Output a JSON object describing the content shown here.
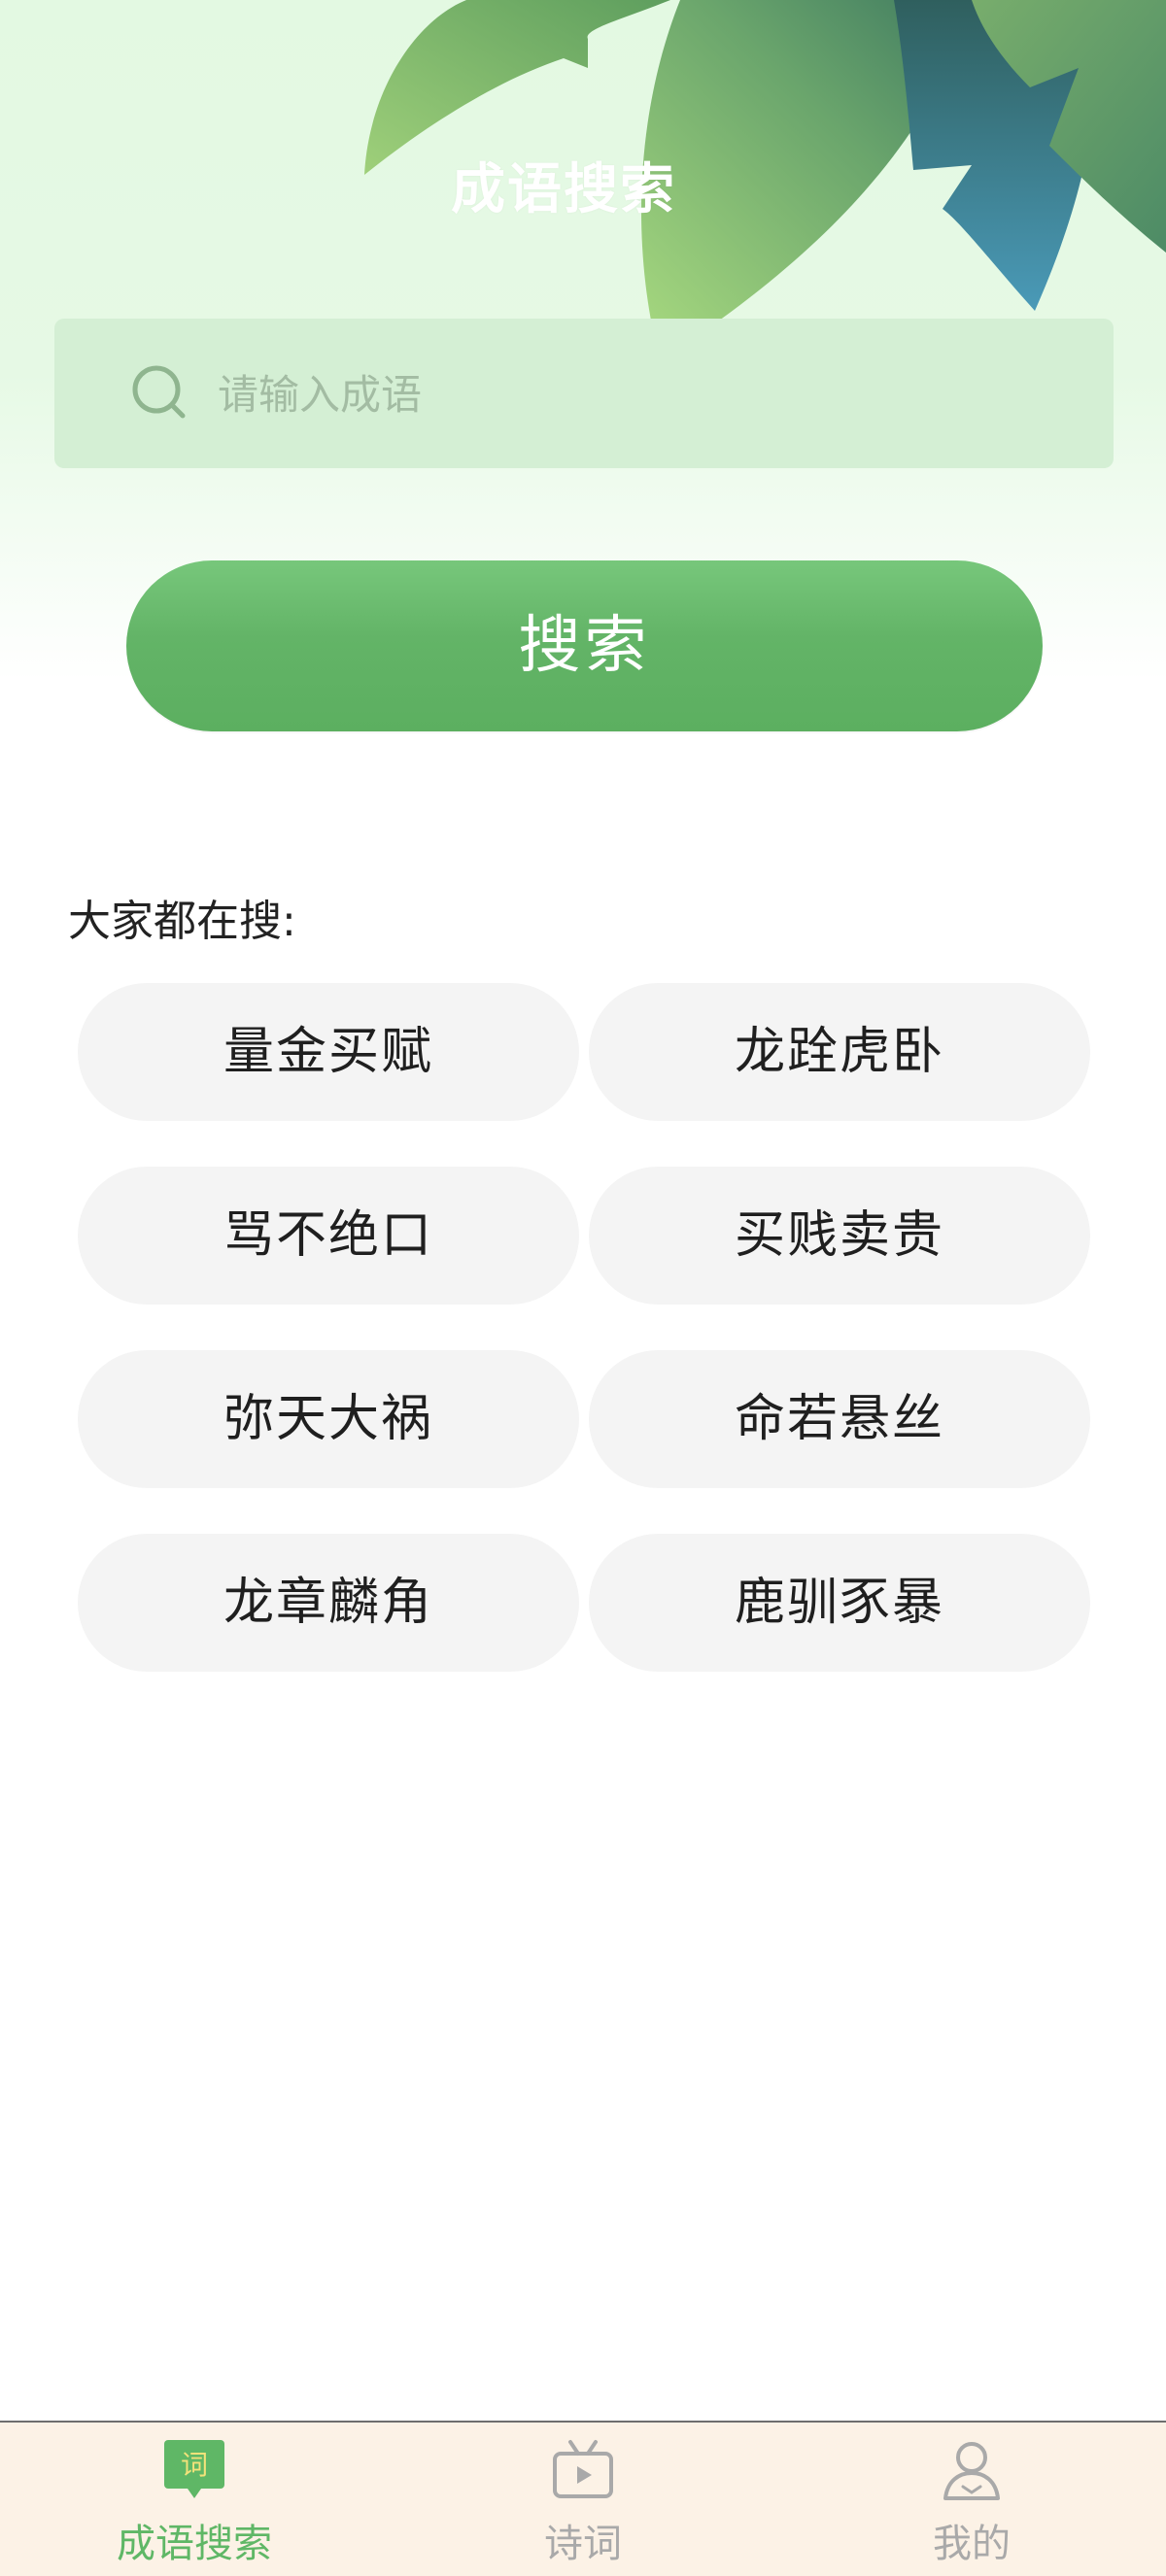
{
  "header": {
    "title": "成语搜索"
  },
  "search": {
    "placeholder": "请输入成语",
    "value": "",
    "button_label": "搜索"
  },
  "popular": {
    "label": "大家都在搜:",
    "items": [
      "量金买赋",
      "龙跧虎卧",
      "骂不绝口",
      "买贱卖贵",
      "弥天大祸",
      "命若悬丝",
      "龙章麟角",
      "鹿驯豕暴"
    ]
  },
  "tabbar": {
    "tabs": [
      {
        "label": "成语搜索",
        "icon": "idiom-chat-icon",
        "icon_text": "词",
        "active": true
      },
      {
        "label": "诗词",
        "icon": "tv-play-icon",
        "active": false
      },
      {
        "label": "我的",
        "icon": "user-icon",
        "active": false
      }
    ],
    "active_color": "#5fb766",
    "inactive_color": "#a9a9a9"
  },
  "colors": {
    "accent": "#63b467",
    "search_box_bg": "#d4efd4",
    "chip_bg": "#f4f4f4",
    "tabbar_bg": "#fcf2e6"
  }
}
